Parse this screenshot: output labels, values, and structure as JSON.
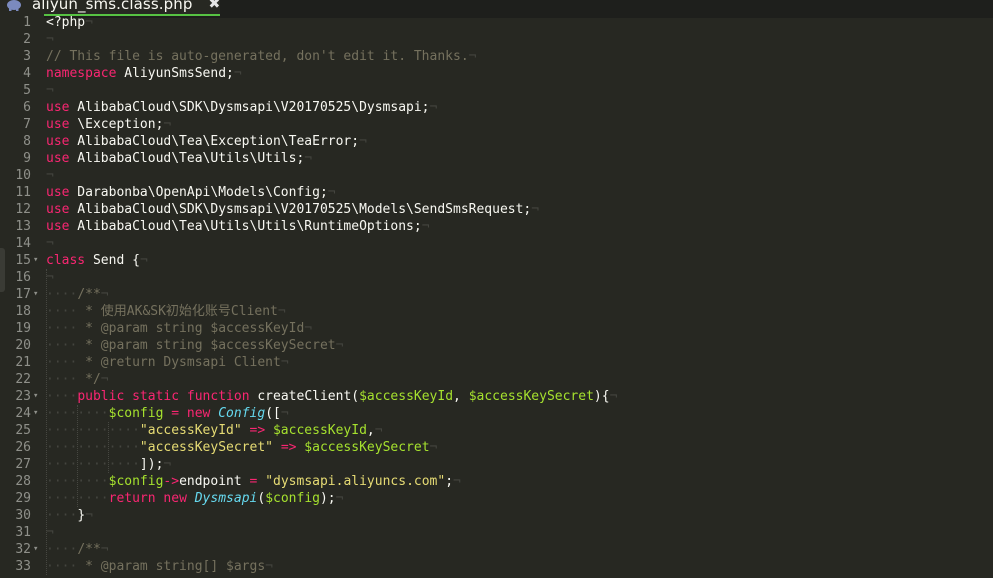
{
  "tab": {
    "filename": "aliyun_sms.class.php",
    "close": "✖"
  },
  "icons": {
    "file": "php-elephant-icon",
    "fold": "fold-arrow-icon"
  },
  "colors": {
    "background": "#272822",
    "keyword": "#f92672",
    "variable": "#a6e22e",
    "string": "#e6db74",
    "comment": "#75715e",
    "function": "#66d9ef",
    "tab_accent": "#57c243"
  },
  "lines": [
    {
      "n": "1",
      "tokens": [
        [
          "pl",
          "<?php"
        ]
      ]
    },
    {
      "n": "2",
      "tokens": []
    },
    {
      "n": "3",
      "tokens": [
        [
          "com",
          "// This file is auto-generated, don't edit it. Thanks."
        ]
      ]
    },
    {
      "n": "4",
      "tokens": [
        [
          "kw",
          "namespace"
        ],
        [
          "pl",
          " AliyunSmsSend;"
        ]
      ]
    },
    {
      "n": "5",
      "tokens": []
    },
    {
      "n": "6",
      "tokens": [
        [
          "kw",
          "use"
        ],
        [
          "pl",
          " AlibabaCloud\\SDK\\Dysmsapi\\V20170525\\Dysmsapi;"
        ]
      ]
    },
    {
      "n": "7",
      "tokens": [
        [
          "kw",
          "use"
        ],
        [
          "pl",
          " \\Exception;"
        ]
      ]
    },
    {
      "n": "8",
      "tokens": [
        [
          "kw",
          "use"
        ],
        [
          "pl",
          " AlibabaCloud\\Tea\\Exception\\TeaError;"
        ]
      ]
    },
    {
      "n": "9",
      "tokens": [
        [
          "kw",
          "use"
        ],
        [
          "pl",
          " AlibabaCloud\\Tea\\Utils\\Utils;"
        ]
      ]
    },
    {
      "n": "10",
      "tokens": []
    },
    {
      "n": "11",
      "tokens": [
        [
          "kw",
          "use"
        ],
        [
          "pl",
          " Darabonba\\OpenApi\\Models\\Config;"
        ]
      ]
    },
    {
      "n": "12",
      "tokens": [
        [
          "kw",
          "use"
        ],
        [
          "pl",
          " AlibabaCloud\\SDK\\Dysmsapi\\V20170525\\Models\\SendSmsRequest;"
        ]
      ]
    },
    {
      "n": "13",
      "tokens": [
        [
          "kw",
          "use"
        ],
        [
          "pl",
          " AlibabaCloud\\Tea\\Utils\\Utils\\RuntimeOptions;"
        ]
      ]
    },
    {
      "n": "14",
      "tokens": []
    },
    {
      "n": "15",
      "fold": true,
      "tokens": [
        [
          "kw",
          "class"
        ],
        [
          "pl",
          " Send {"
        ]
      ]
    },
    {
      "n": "16",
      "tokens": []
    },
    {
      "n": "17",
      "fold": true,
      "tokens": [
        [
          "ws",
          "    "
        ],
        [
          "com",
          "/**"
        ]
      ]
    },
    {
      "n": "18",
      "tokens": [
        [
          "ws",
          "    "
        ],
        [
          "com",
          " * 使用AK&SK初始化账号Client"
        ]
      ]
    },
    {
      "n": "19",
      "tokens": [
        [
          "ws",
          "    "
        ],
        [
          "com",
          " * @param string $accessKeyId"
        ]
      ]
    },
    {
      "n": "20",
      "tokens": [
        [
          "ws",
          "    "
        ],
        [
          "com",
          " * @param string $accessKeySecret"
        ]
      ]
    },
    {
      "n": "21",
      "tokens": [
        [
          "ws",
          "    "
        ],
        [
          "com",
          " * @return Dysmsapi Client"
        ]
      ]
    },
    {
      "n": "22",
      "tokens": [
        [
          "ws",
          "    "
        ],
        [
          "com",
          " */"
        ]
      ]
    },
    {
      "n": "23",
      "fold": true,
      "tokens": [
        [
          "ws",
          "    "
        ],
        [
          "kw",
          "public"
        ],
        [
          "pl",
          " "
        ],
        [
          "kw",
          "static"
        ],
        [
          "pl",
          " "
        ],
        [
          "kw",
          "function"
        ],
        [
          "pl",
          " createClient("
        ],
        [
          "var",
          "$accessKeyId"
        ],
        [
          "pl",
          ", "
        ],
        [
          "var",
          "$accessKeySecret"
        ],
        [
          "pl",
          "){"
        ]
      ]
    },
    {
      "n": "24",
      "fold": true,
      "tokens": [
        [
          "ws",
          "        "
        ],
        [
          "var",
          "$config"
        ],
        [
          "pl",
          " "
        ],
        [
          "kw",
          "="
        ],
        [
          "pl",
          " "
        ],
        [
          "kw",
          "new"
        ],
        [
          "pl",
          " "
        ],
        [
          "sto",
          "Config"
        ],
        [
          "pl",
          "(["
        ]
      ]
    },
    {
      "n": "25",
      "tokens": [
        [
          "ws",
          "            "
        ],
        [
          "str",
          "\"accessKeyId\""
        ],
        [
          "pl",
          " "
        ],
        [
          "kw",
          "=>"
        ],
        [
          "pl",
          " "
        ],
        [
          "var",
          "$accessKeyId"
        ],
        [
          "pl",
          ","
        ]
      ]
    },
    {
      "n": "26",
      "tokens": [
        [
          "ws",
          "            "
        ],
        [
          "str",
          "\"accessKeySecret\""
        ],
        [
          "pl",
          " "
        ],
        [
          "kw",
          "=>"
        ],
        [
          "pl",
          " "
        ],
        [
          "var",
          "$accessKeySecret"
        ]
      ]
    },
    {
      "n": "27",
      "tokens": [
        [
          "ws",
          "            "
        ],
        [
          "pl",
          "]);"
        ]
      ]
    },
    {
      "n": "28",
      "tokens": [
        [
          "ws",
          "        "
        ],
        [
          "var",
          "$config"
        ],
        [
          "kw",
          "->"
        ],
        [
          "pl",
          "endpoint "
        ],
        [
          "kw",
          "="
        ],
        [
          "pl",
          " "
        ],
        [
          "str",
          "\"dysmsapi.aliyuncs.com\""
        ],
        [
          "pl",
          ";"
        ]
      ]
    },
    {
      "n": "29",
      "tokens": [
        [
          "ws",
          "        "
        ],
        [
          "kw",
          "return"
        ],
        [
          "pl",
          " "
        ],
        [
          "kw",
          "new"
        ],
        [
          "pl",
          " "
        ],
        [
          "sto",
          "Dysmsapi"
        ],
        [
          "pl",
          "("
        ],
        [
          "var",
          "$config"
        ],
        [
          "pl",
          ");"
        ]
      ]
    },
    {
      "n": "30",
      "tokens": [
        [
          "ws",
          "    "
        ],
        [
          "pl",
          "}"
        ]
      ]
    },
    {
      "n": "31",
      "tokens": []
    },
    {
      "n": "32",
      "fold": true,
      "tokens": [
        [
          "ws",
          "    "
        ],
        [
          "com",
          "/**"
        ]
      ]
    },
    {
      "n": "33",
      "tokens": [
        [
          "ws",
          "    "
        ],
        [
          "com",
          " * @param string[] $args"
        ]
      ]
    }
  ]
}
